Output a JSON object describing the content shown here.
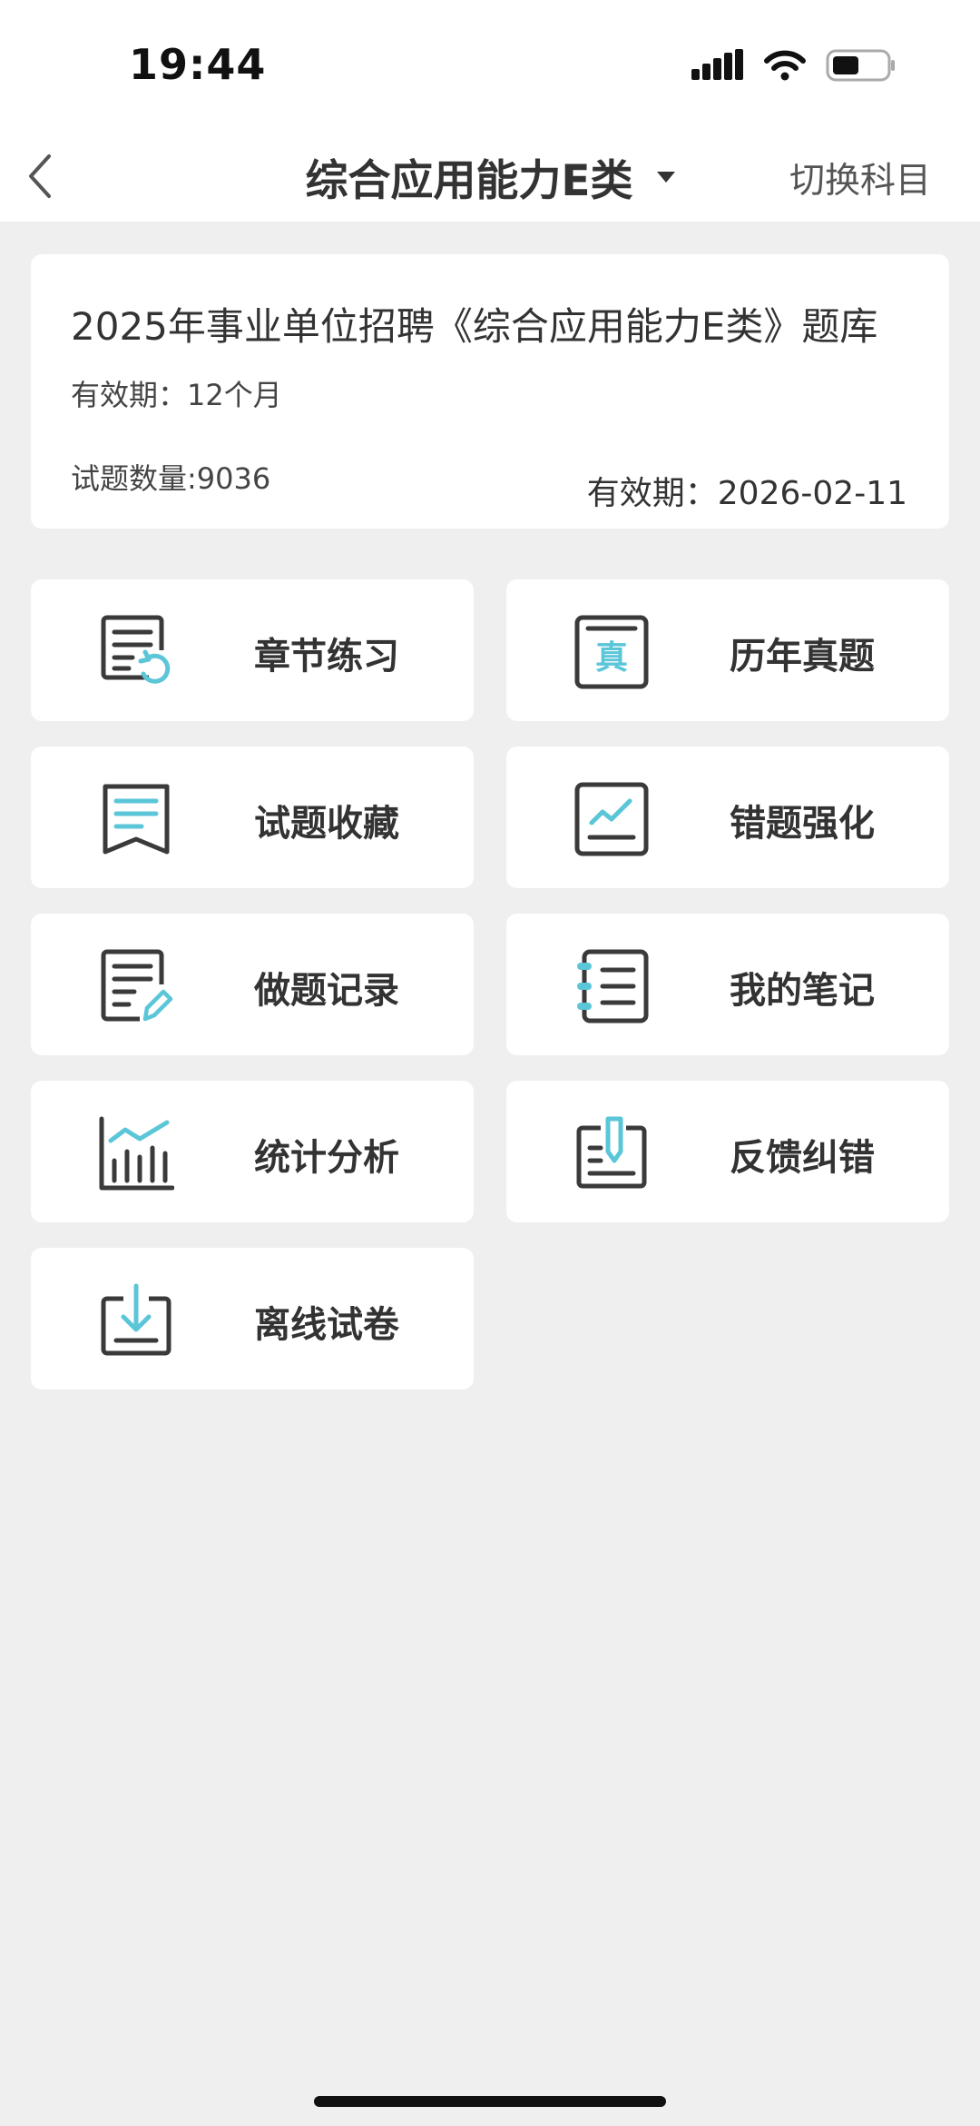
{
  "status_bar": {
    "time": "19:44"
  },
  "nav": {
    "title": "综合应用能力E类",
    "switch_label": "切换科目"
  },
  "info": {
    "title": "2025年事业单位招聘《综合应用能力E类》题库",
    "validity": "有效期：12个月",
    "question_count": "试题数量:9036",
    "expire": "有效期：2026-02-11"
  },
  "colors": {
    "accent": "#5bc6d8",
    "icon_dark": "#3a3a3a",
    "bg": "#efefef"
  },
  "menu": [
    {
      "label": "章节练习",
      "icon": "chapter-practice-icon"
    },
    {
      "label": "历年真题",
      "icon": "past-exams-icon"
    },
    {
      "label": "试题收藏",
      "icon": "favorites-icon"
    },
    {
      "label": "错题强化",
      "icon": "wrong-questions-icon"
    },
    {
      "label": "做题记录",
      "icon": "practice-record-icon"
    },
    {
      "label": "我的笔记",
      "icon": "notes-icon"
    },
    {
      "label": "统计分析",
      "icon": "statistics-icon"
    },
    {
      "label": "反馈纠错",
      "icon": "feedback-icon"
    },
    {
      "label": "离线试卷",
      "icon": "offline-papers-icon"
    }
  ]
}
